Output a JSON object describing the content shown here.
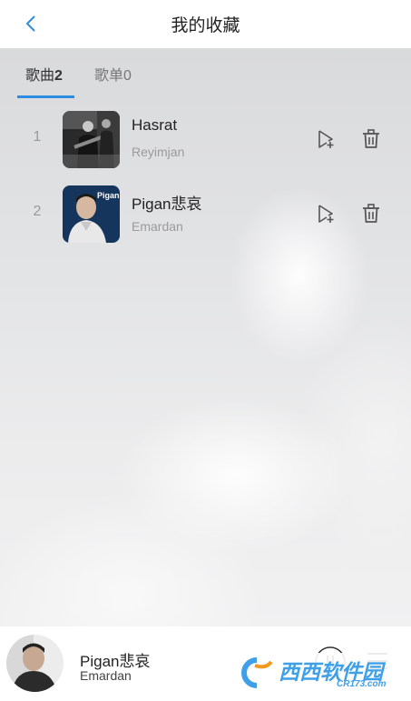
{
  "header": {
    "title": "我的收藏"
  },
  "tabs": [
    {
      "label": "歌曲",
      "count": "2"
    },
    {
      "label": "歌单",
      "count": "0"
    }
  ],
  "songs": [
    {
      "index": "1",
      "name": "Hasrat",
      "artist": "Reyimjan"
    },
    {
      "index": "2",
      "name": "Pigan悲哀",
      "artist": "Emardan",
      "cover_text": "Pigan"
    }
  ],
  "player": {
    "name": "Pigan悲哀",
    "artist": "Emardan"
  },
  "watermark": {
    "text": "西西软件园",
    "sub": "CR173.com"
  },
  "colors": {
    "accent": "#2c8ce4",
    "icon": "#555555"
  },
  "icons": {
    "back": "chevron-left-icon",
    "add": "add-to-playlist-icon",
    "delete": "trash-icon",
    "play": "play-pause-icon",
    "list": "playlist-icon"
  }
}
